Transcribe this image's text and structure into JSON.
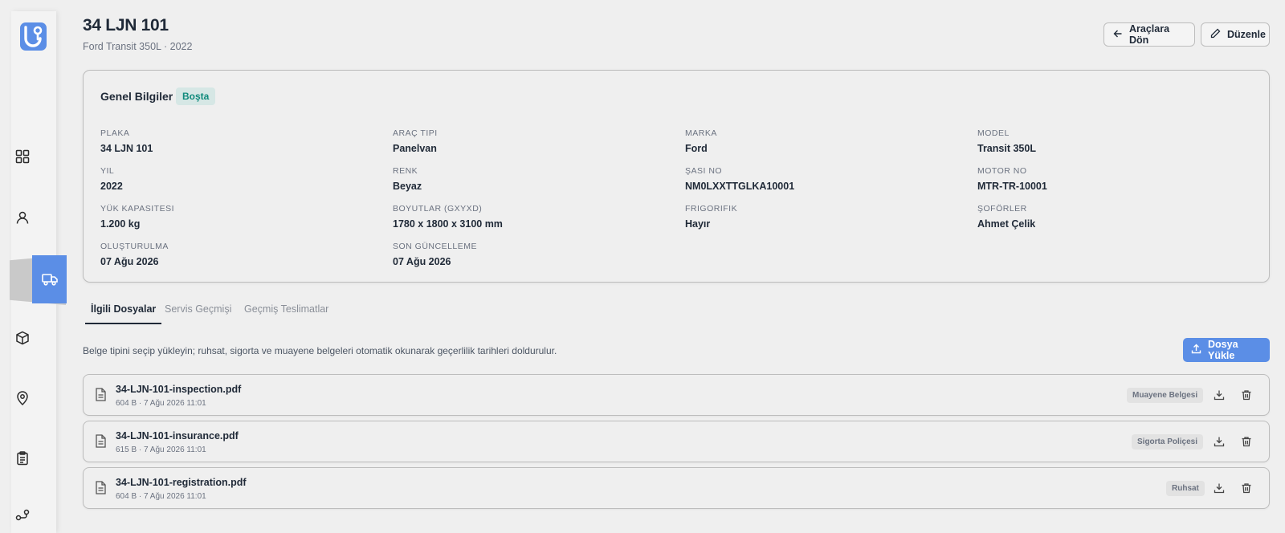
{
  "header": {
    "title": "34 LJN 101",
    "subtitle": "Ford Transit 350L · 2022",
    "back_label": "Araçlara Dön",
    "edit_label": "Düzenle"
  },
  "sidebar": {
    "items": [
      {
        "icon": "dashboard-grid-icon"
      },
      {
        "icon": "user-icon"
      },
      {
        "icon": "truck-icon",
        "active": true
      },
      {
        "icon": "box-icon"
      },
      {
        "icon": "map-pin-icon"
      },
      {
        "icon": "clipboard-icon"
      }
    ],
    "accent": "#5b8ee6"
  },
  "general": {
    "title": "Genel Bilgiler",
    "status": "Boşta",
    "fields": [
      {
        "label": "PLAKA",
        "value": "34 LJN 101"
      },
      {
        "label": "ARAÇ TIPI",
        "value": "Panelvan"
      },
      {
        "label": "MARKA",
        "value": "Ford"
      },
      {
        "label": "MODEL",
        "value": "Transit 350L"
      },
      {
        "label": "YIL",
        "value": "2022"
      },
      {
        "label": "RENK",
        "value": "Beyaz"
      },
      {
        "label": "ŞASI NO",
        "value": "NM0LXXTTGLKA10001"
      },
      {
        "label": "MOTOR NO",
        "value": "MTR-TR-10001"
      },
      {
        "label": "YÜK KAPASITESI",
        "value": "1.200 kg"
      },
      {
        "label": "BOYUTLAR (GXYXD)",
        "value": "1780 x 1800 x 3100 mm"
      },
      {
        "label": "FRIGORIFIK",
        "value": "Hayır"
      },
      {
        "label": "ŞOFÖRLER",
        "value": "Ahmet Çelik"
      },
      {
        "label": "OLUŞTURULMA",
        "value": "07 Ağu 2026"
      },
      {
        "label": "SON GÜNCELLEME",
        "value": "07 Ağu 2026"
      }
    ]
  },
  "tabs": [
    {
      "label": "İlgili Dosyalar",
      "active": true
    },
    {
      "label": "Servis Geçmişi",
      "active": false
    },
    {
      "label": "Geçmiş Teslimatlar",
      "active": false
    }
  ],
  "files": {
    "hint": "Belge tipini seçip yükleyin; ruhsat, sigorta ve muayene belgeleri otomatik okunarak geçerlilik tarihleri doldurulur.",
    "upload_label": "Dosya Yükle",
    "items": [
      {
        "name": "34-LJN-101-inspection.pdf",
        "meta": "604 B · 7 Ağu 2026 11:01",
        "type": "Muayene Belgesi"
      },
      {
        "name": "34-LJN-101-insurance.pdf",
        "meta": "615 B · 7 Ağu 2026 11:01",
        "type": "Sigorta Poliçesi"
      },
      {
        "name": "34-LJN-101-registration.pdf",
        "meta": "604 B · 7 Ağu 2026 11:01",
        "type": "Ruhsat"
      }
    ]
  }
}
